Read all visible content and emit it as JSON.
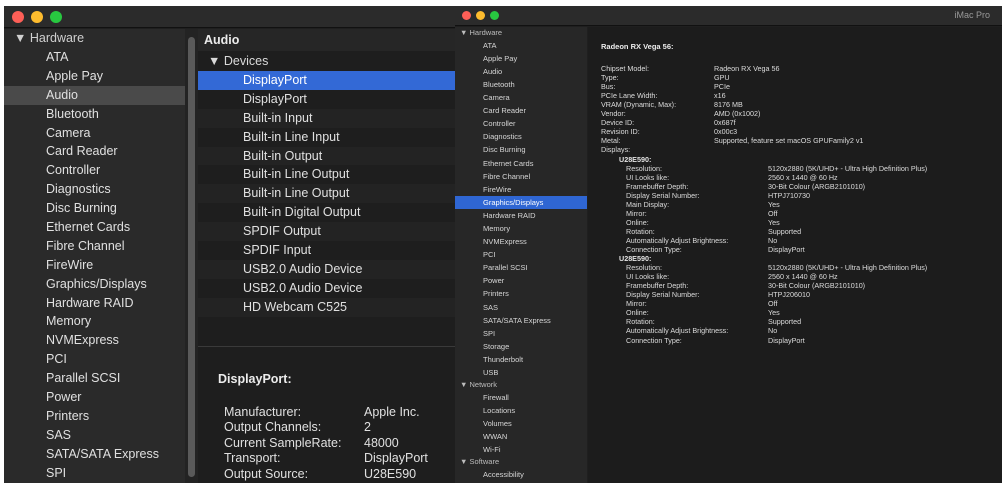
{
  "left_window": {
    "sidebar": {
      "header": "Hardware",
      "items": [
        "ATA",
        "Apple Pay",
        "Audio",
        "Bluetooth",
        "Camera",
        "Card Reader",
        "Controller",
        "Diagnostics",
        "Disc Burning",
        "Ethernet Cards",
        "Fibre Channel",
        "FireWire",
        "Graphics/Displays",
        "Hardware RAID",
        "Memory",
        "NVMExpress",
        "PCI",
        "Parallel SCSI",
        "Power",
        "Printers",
        "SAS",
        "SATA/SATA Express",
        "SPI"
      ],
      "selected": "Audio"
    },
    "section_title": "Audio",
    "devices_header": "Devices",
    "devices": [
      "DisplayPort",
      "DisplayPort",
      "Built-in Input",
      "Built-in Line Input",
      "Built-in Output",
      "Built-in Line Output",
      "Built-in Line Output",
      "Built-in Digital Output",
      "SPDIF Output",
      "SPDIF Input",
      "USB2.0 Audio Device",
      "USB2.0 Audio Device",
      "HD Webcam C525"
    ],
    "selected_device_index": 0,
    "detail": {
      "title": "DisplayPort:",
      "rows": [
        {
          "key": "Manufacturer:",
          "value": "Apple Inc."
        },
        {
          "key": "Output Channels:",
          "value": "2"
        },
        {
          "key": "Current SampleRate:",
          "value": "48000"
        },
        {
          "key": "Transport:",
          "value": "DisplayPort"
        },
        {
          "key": "Output Source:",
          "value": "U28E590"
        }
      ]
    }
  },
  "right_window": {
    "title": "iMac Pro",
    "sidebar": {
      "groups": [
        {
          "header": "Hardware",
          "items": [
            "ATA",
            "Apple Pay",
            "Audio",
            "Bluetooth",
            "Camera",
            "Card Reader",
            "Controller",
            "Diagnostics",
            "Disc Burning",
            "Ethernet Cards",
            "Fibre Channel",
            "FireWire",
            "Graphics/Displays",
            "Hardware RAID",
            "Memory",
            "NVMExpress",
            "PCI",
            "Parallel SCSI",
            "Power",
            "Printers",
            "SAS",
            "SATA/SATA Express",
            "SPI",
            "Storage",
            "Thunderbolt",
            "USB"
          ]
        },
        {
          "header": "Network",
          "items": [
            "Firewall",
            "Locations",
            "Volumes",
            "WWAN",
            "Wi-Fi"
          ]
        },
        {
          "header": "Software",
          "items": [
            "Accessibility"
          ]
        }
      ],
      "selected": "Graphics/Displays"
    },
    "gpu_title": "Radeon RX Vega 56:",
    "gpu_rows": [
      {
        "key": "Chipset Model:",
        "value": "Radeon RX Vega 56"
      },
      {
        "key": "Type:",
        "value": "GPU"
      },
      {
        "key": "Bus:",
        "value": "PCIe"
      },
      {
        "key": "PCIe Lane Width:",
        "value": "x16"
      },
      {
        "key": "VRAM (Dynamic, Max):",
        "value": "8176 MB"
      },
      {
        "key": "Vendor:",
        "value": "AMD (0x1002)"
      },
      {
        "key": "Device ID:",
        "value": "0x687f"
      },
      {
        "key": "Revision ID:",
        "value": "0x00c3"
      },
      {
        "key": "Metal:",
        "value": "Supported, feature set macOS GPUFamily2 v1"
      },
      {
        "key": "Displays:",
        "value": ""
      }
    ],
    "displays": [
      {
        "name": "U28E590:",
        "rows": [
          {
            "key": "Resolution:",
            "value": "5120x2880 (5K/UHD+ - Ultra High Definition Plus)"
          },
          {
            "key": "UI Looks like:",
            "value": "2560 x 1440 @ 60 Hz"
          },
          {
            "key": "Framebuffer Depth:",
            "value": "30-Bit Colour (ARGB2101010)"
          },
          {
            "key": "Display Serial Number:",
            "value": "HTPJ710730"
          },
          {
            "key": "Main Display:",
            "value": "Yes"
          },
          {
            "key": "Mirror:",
            "value": "Off"
          },
          {
            "key": "Online:",
            "value": "Yes"
          },
          {
            "key": "Rotation:",
            "value": "Supported"
          },
          {
            "key": "Automatically Adjust Brightness:",
            "value": "No"
          },
          {
            "key": "Connection Type:",
            "value": "DisplayPort"
          }
        ]
      },
      {
        "name": "U28E590:",
        "rows": [
          {
            "key": "Resolution:",
            "value": "5120x2880 (5K/UHD+ - Ultra High Definition Plus)"
          },
          {
            "key": "UI Looks like:",
            "value": "2560 x 1440 @ 60 Hz"
          },
          {
            "key": "Framebuffer Depth:",
            "value": "30-Bit Colour (ARGB2101010)"
          },
          {
            "key": "Display Serial Number:",
            "value": "HTPJ206010"
          },
          {
            "key": "Mirror:",
            "value": "Off"
          },
          {
            "key": "Online:",
            "value": "Yes"
          },
          {
            "key": "Rotation:",
            "value": "Supported"
          },
          {
            "key": "Automatically Adjust Brightness:",
            "value": "No"
          },
          {
            "key": "Connection Type:",
            "value": "DisplayPort"
          }
        ]
      }
    ]
  },
  "colors": {
    "selection_blue": "#3369d6",
    "sidebar_selected_gray": "#4a4a4a",
    "window_background": "#1f1f1f",
    "text": "#e0e0e0"
  }
}
